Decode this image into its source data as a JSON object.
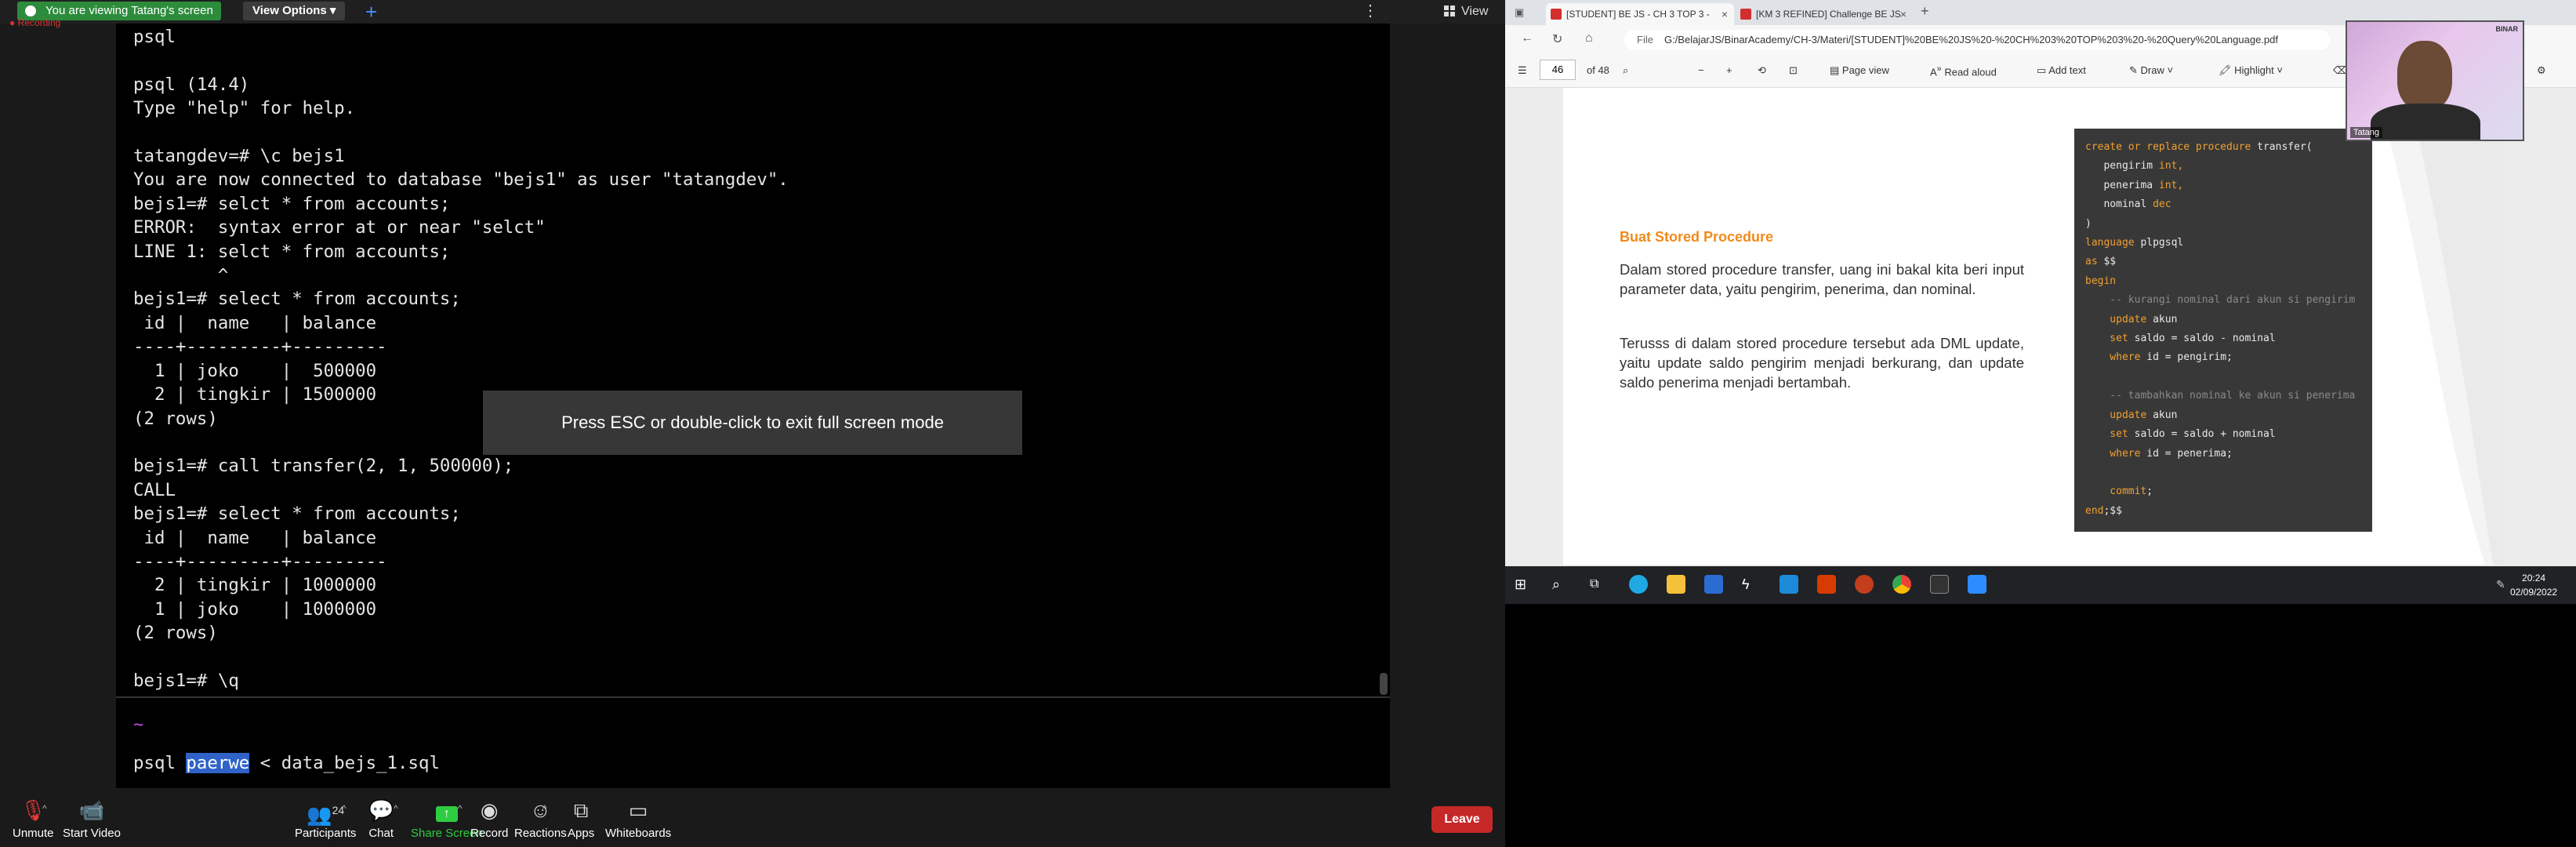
{
  "zoom": {
    "share_banner": "You are viewing Tatang's screen",
    "view_options": "View Options",
    "view_label": "View",
    "esc_toast": "Press ESC or double-click to exit full screen mode",
    "recording_label": "Recording",
    "toolbar": {
      "unmute": "Unmute",
      "start_video": "Start Video",
      "participants": "Participants",
      "participants_count": "24",
      "chat": "Chat",
      "share_screen": "Share Screen",
      "record": "Record",
      "reactions": "Reactions",
      "apps": "Apps",
      "whiteboards": "Whiteboards",
      "leave": "Leave"
    }
  },
  "terminal": {
    "lines": [
      "psql",
      "",
      "psql (14.4)",
      "Type \"help\" for help.",
      "",
      "tatangdev=# \\c bejs1",
      "You are now connected to database \"bejs1\" as user \"tatangdev\".",
      "bejs1=# selct * from accounts;",
      "ERROR:  syntax error at or near \"selct\"",
      "LINE 1: selct * from accounts;",
      "        ^",
      "bejs1=# select * from accounts;",
      " id |  name   | balance",
      "----+---------+---------",
      "  1 | joko    |  500000",
      "  2 | tingkir | 1500000",
      "(2 rows)",
      "",
      "bejs1=# call transfer(2, 1, 500000);",
      "CALL",
      "bejs1=# select * from accounts;",
      " id |  name   | balance",
      "----+---------+---------",
      "  2 | tingkir | 1000000",
      "  1 | joko    | 1000000",
      "(2 rows)",
      "",
      "bejs1=# \\q"
    ],
    "tilde": "~",
    "input_prefix": "psql ",
    "input_selected": "paerwe",
    "input_suffix": " < data_bejs_1.sql"
  },
  "browser": {
    "tabs": [
      {
        "label": "[STUDENT] BE JS - CH 3 TOP 3 -"
      },
      {
        "label": "[KM 3 REFINED] Challenge BE JS"
      }
    ],
    "file_label": "File",
    "address": "G:/BelajarJS/BinarAcademy/CH-3/Materi/[STUDENT]%20BE%20JS%20-%20CH%203%20TOP%203%20-%20Query%20Language.pdf",
    "page_current": "46",
    "page_total": "of 48",
    "page_view": "Page view",
    "read_aloud": "Read aloud",
    "add_text": "Add text",
    "draw": "Draw",
    "highlight": "Highlight"
  },
  "pdf": {
    "section_title": "Buat Stored Procedure",
    "paragraph1": "Dalam stored procedure transfer, uang ini bakal kita beri input parameter data, yaitu pengirim, penerima, dan nominal.",
    "paragraph2": "Terusss di dalam stored procedure tersebut ada DML update, yaitu update saldo pengirim menjadi berkurang, dan update saldo penerima menjadi bertambah.",
    "code": {
      "l1a": "create or replace procedure",
      "l1b": " transfer(",
      "l2": "   pengirim ",
      "l2t": "int,",
      "l3": "   penerima ",
      "l3t": "int,",
      "l4": "   nominal ",
      "l4t": "dec",
      "l5": ")",
      "l6a": "language",
      "l6b": " plpgsql",
      "l7a": "as",
      "l7b": " $$",
      "l8": "begin",
      "l9": "    -- kurangi nominal dari akun si pengirim",
      "l10a": "    update",
      "l10b": " akun",
      "l11a": "    set",
      "l11b": " saldo = saldo - nominal",
      "l12a": "    where",
      "l12b": " id = pengirim;",
      "l13": "    -- tambahkan nominal ke akun si penerima",
      "l14a": "    update",
      "l14b": " akun",
      "l15a": "    set",
      "l15b": " saldo = saldo + nominal",
      "l16a": "    where",
      "l16b": " id = penerima;",
      "l17a": "    commit",
      "l17b": ";",
      "l18a": "end",
      "l18b": ";$$"
    }
  },
  "webcam": {
    "name": "Tatang",
    "logo": "BINAR"
  },
  "taskbar": {
    "time": "20:24",
    "date": "02/09/2022"
  }
}
